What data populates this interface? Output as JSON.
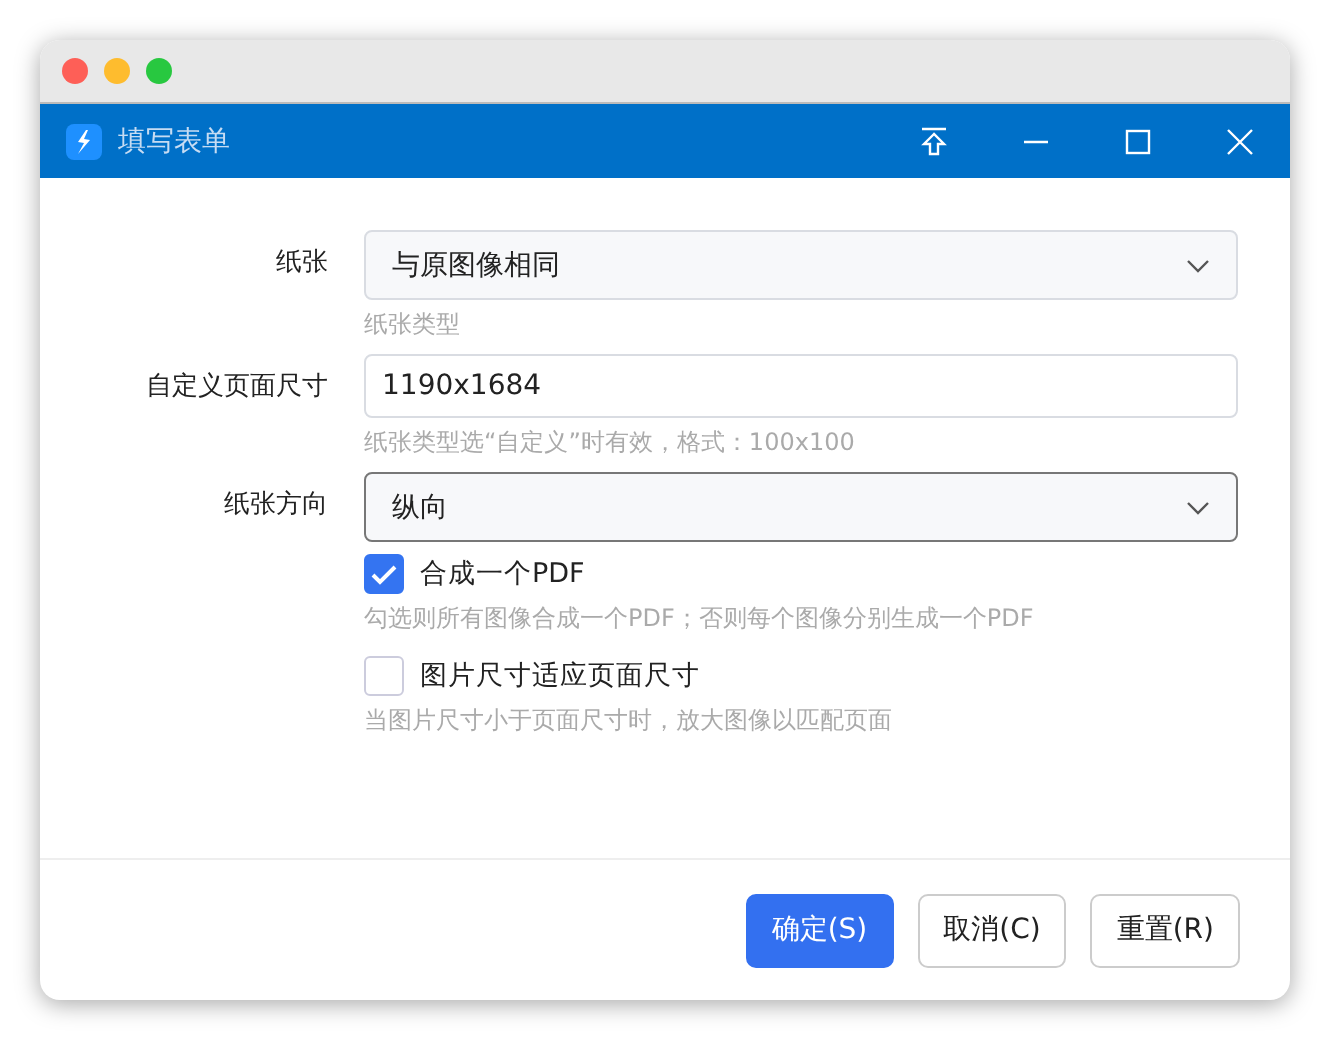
{
  "window": {
    "title": "填写表单"
  },
  "fields": [
    {
      "kind": "select",
      "label": "纸张",
      "value": "与原图像相同",
      "hint": "纸张类型",
      "focused": false
    },
    {
      "kind": "input",
      "label": "自定义页面尺寸",
      "value": "1190x1684",
      "hint": "纸张类型选“自定义”时有效，格式：100x100",
      "focused": false
    },
    {
      "kind": "select",
      "label": "纸张方向",
      "value": "纵向",
      "focused": true
    }
  ],
  "checkboxes": [
    {
      "label": "合成一个PDF",
      "checked": true,
      "hint": "勾选则所有图像合成一个PDF；否则每个图像分别生成一个PDF"
    },
    {
      "label": "图片尺寸适应页面尺寸",
      "checked": false,
      "hint": "当图片尺寸小于页面尺寸时，放大图像以匹配页面"
    }
  ],
  "buttons": [
    {
      "label": "确定(S)",
      "primary": true
    },
    {
      "label": "取消(C)",
      "primary": false
    },
    {
      "label": "重置(R)",
      "primary": false
    }
  ]
}
